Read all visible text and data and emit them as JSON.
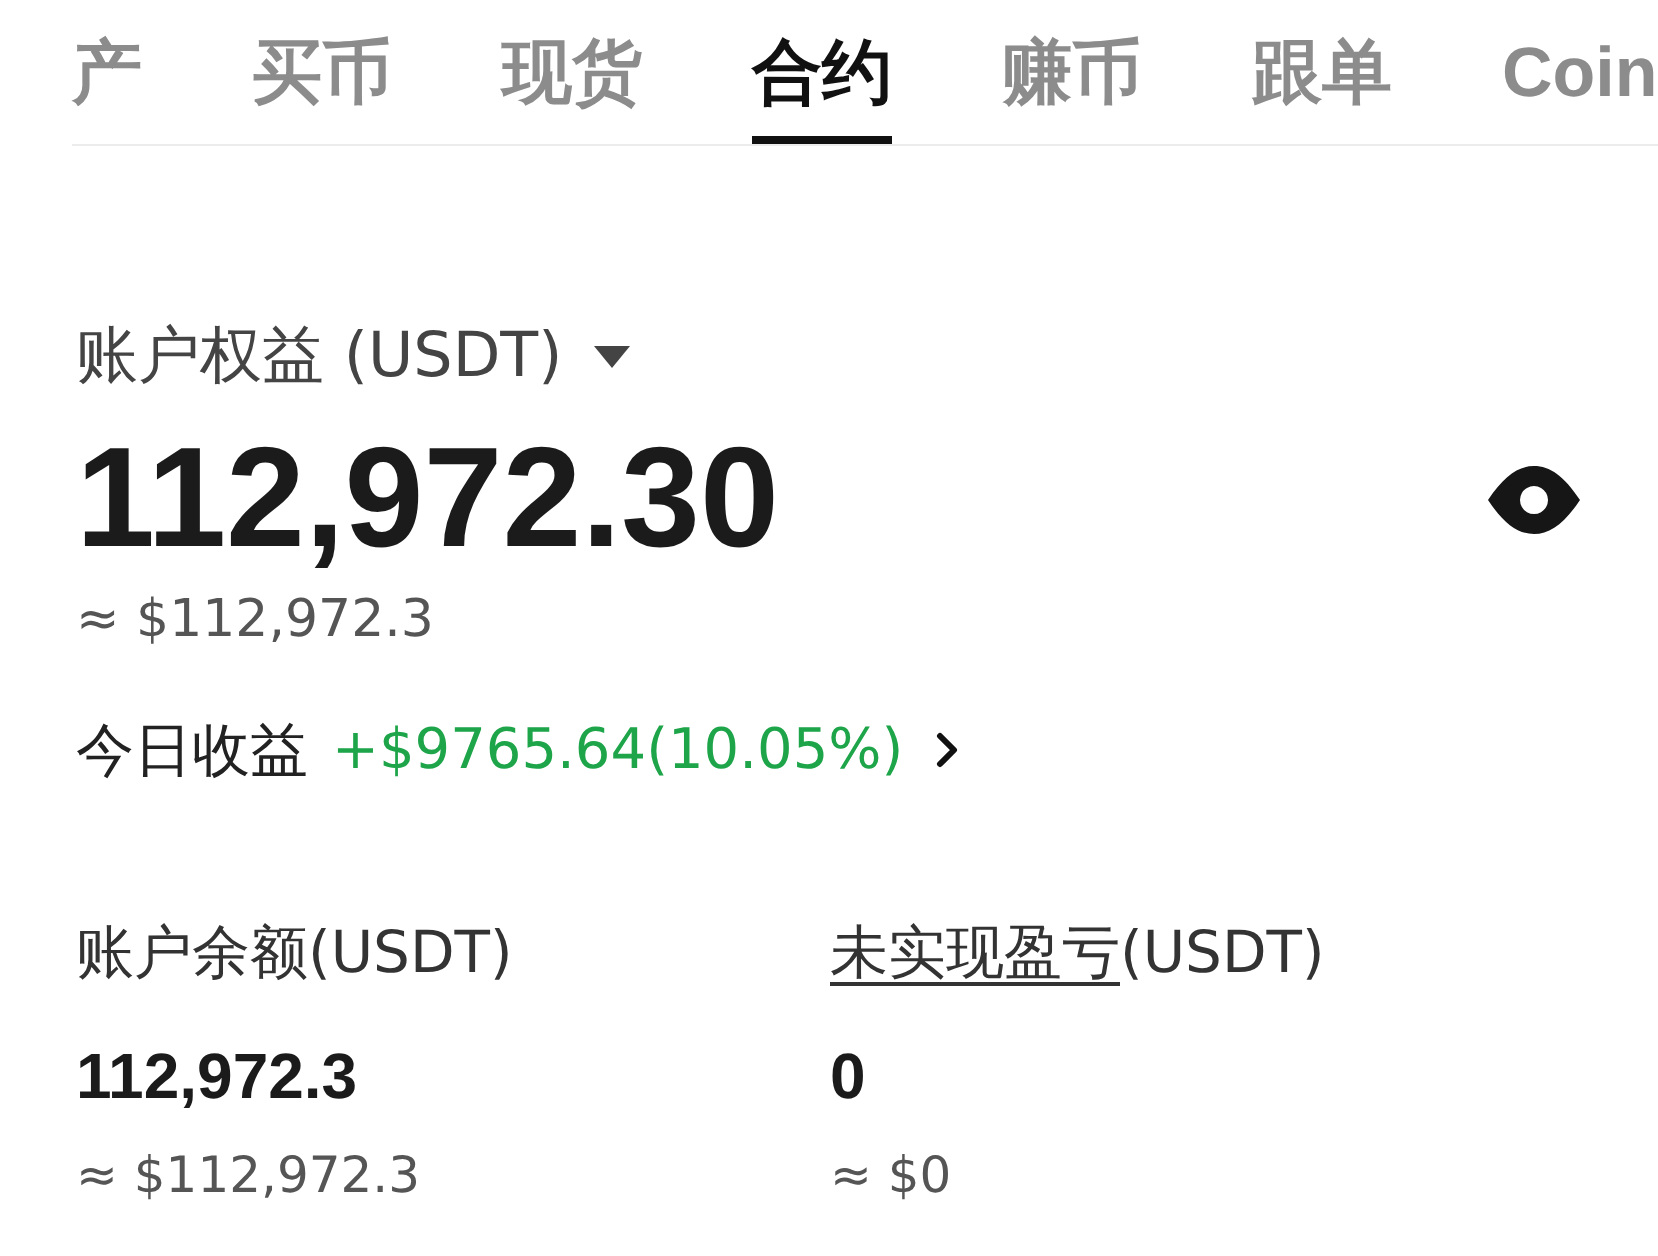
{
  "tabs": [
    {
      "label": "产",
      "selected": false
    },
    {
      "label": "买币",
      "selected": false
    },
    {
      "label": "现货",
      "selected": false
    },
    {
      "label": "合约",
      "selected": true
    },
    {
      "label": "赚币",
      "selected": false
    },
    {
      "label": "跟单",
      "selected": false
    },
    {
      "label": "Coin",
      "selected": false
    }
  ],
  "equity": {
    "label": "账户权益 (USDT)",
    "value": "112,972.30",
    "approx": "≈ $112,972.3"
  },
  "today_pnl": {
    "label": "今日收益",
    "value": "+$9765.64(10.05%)",
    "positive": true
  },
  "stats": [
    {
      "label": "账户余额",
      "unit": "(USDT)",
      "underlined": false,
      "value": "112,972.3",
      "approx": "≈ $112,972.3"
    },
    {
      "label": "未实现盈亏",
      "unit": "(USDT)",
      "underlined": true,
      "value": "0",
      "approx": "≈ $0"
    }
  ]
}
